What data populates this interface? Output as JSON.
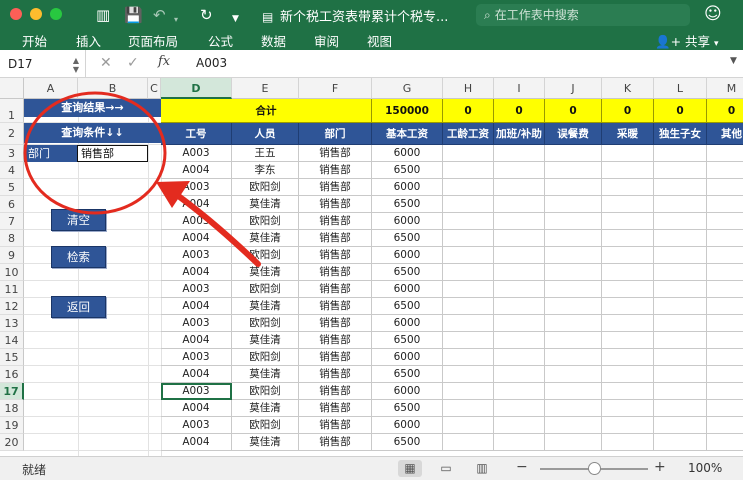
{
  "window": {
    "title": "新个税工资表带累计个税专...",
    "search_placeholder": "在工作表中搜索"
  },
  "ribbon": {
    "tabs": [
      "开始",
      "插入",
      "页面布局",
      "公式",
      "数据",
      "审阅",
      "视图"
    ],
    "share_label": "共享"
  },
  "formula_bar": {
    "cell_ref": "D17",
    "fx_label": "fx",
    "value": "A003"
  },
  "grid": {
    "columns": [
      "A",
      "B",
      "C",
      "D",
      "E",
      "F",
      "G",
      "H",
      "I",
      "J",
      "K",
      "L",
      "M"
    ],
    "selected_column": "D",
    "rows": [
      "1",
      "2",
      "3",
      "4",
      "5",
      "6",
      "7",
      "8",
      "9",
      "10",
      "11",
      "12",
      "13",
      "14",
      "15",
      "16",
      "17",
      "18",
      "19",
      "20"
    ],
    "selected_row": "17"
  },
  "panel": {
    "query_result_label": "查询结果→→",
    "query_condition_label": "查询条件↓↓",
    "dept_label": "部门",
    "dept_value": "销售部",
    "buttons": {
      "clear": "清空",
      "search": "检索",
      "back": "返回"
    }
  },
  "table": {
    "total_label": "合计",
    "total_values": [
      "150000",
      "0",
      "0",
      "0",
      "0",
      "0",
      "0"
    ],
    "headers": [
      "工号",
      "人员",
      "部门",
      "基本工资",
      "工龄工资",
      "加班/补助",
      "误餐费",
      "采暖",
      "独生子女",
      "其他"
    ],
    "rows": [
      [
        "A003",
        "王五",
        "销售部",
        "6000"
      ],
      [
        "A004",
        "李东",
        "销售部",
        "6500"
      ],
      [
        "A003",
        "欧阳剑",
        "销售部",
        "6000"
      ],
      [
        "A004",
        "莫佳清",
        "销售部",
        "6500"
      ],
      [
        "A003",
        "欧阳剑",
        "销售部",
        "6000"
      ],
      [
        "A004",
        "莫佳清",
        "销售部",
        "6500"
      ],
      [
        "A003",
        "欧阳剑",
        "销售部",
        "6000"
      ],
      [
        "A004",
        "莫佳清",
        "销售部",
        "6500"
      ],
      [
        "A003",
        "欧阳剑",
        "销售部",
        "6000"
      ],
      [
        "A004",
        "莫佳清",
        "销售部",
        "6500"
      ],
      [
        "A003",
        "欧阳剑",
        "销售部",
        "6000"
      ],
      [
        "A004",
        "莫佳清",
        "销售部",
        "6500"
      ],
      [
        "A003",
        "欧阳剑",
        "销售部",
        "6000"
      ],
      [
        "A004",
        "莫佳清",
        "销售部",
        "6500"
      ],
      [
        "A003",
        "欧阳剑",
        "销售部",
        "6000"
      ],
      [
        "A004",
        "莫佳清",
        "销售部",
        "6500"
      ],
      [
        "A003",
        "欧阳剑",
        "销售部",
        "6000"
      ],
      [
        "A004",
        "莫佳清",
        "销售部",
        "6500"
      ]
    ]
  },
  "annotation": {
    "color": "#e32b1f"
  },
  "status_bar": {
    "ready_label": "就绪",
    "zoom_level": "100%",
    "zoom_fraction": 0.5
  },
  "colors": {
    "accent_green": "#1f7145",
    "header_blue": "#2f5597",
    "total_yellow": "#ffff00"
  }
}
